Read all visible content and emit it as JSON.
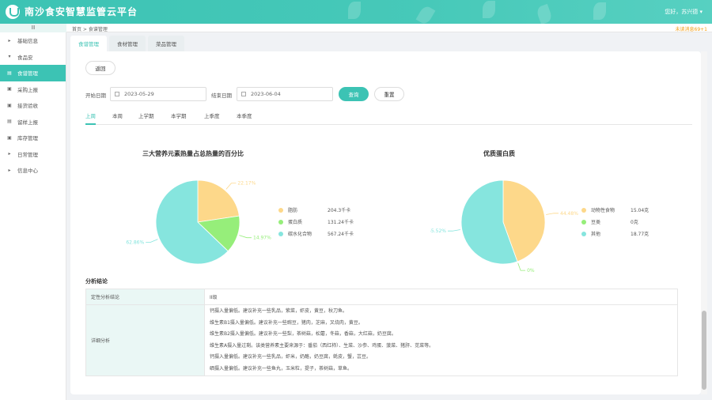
{
  "header": {
    "title": "南沙食安智慧监管云平台",
    "user": "您好，苏兴德 ▾"
  },
  "subbar": {
    "collapse_icon": "Ⅲ",
    "breadcrumb": "首页 > 食谱管理",
    "notice": "未读消息69+1"
  },
  "sidebar": {
    "items": [
      {
        "label": "基础信息",
        "icon": "▸"
      },
      {
        "label": "食品安",
        "icon": "▾"
      },
      {
        "label": "食谱管理",
        "icon": "▤"
      },
      {
        "label": "采购上报",
        "icon": "▣"
      },
      {
        "label": "接货验收",
        "icon": "▣"
      },
      {
        "label": "留样上报",
        "icon": "▤"
      },
      {
        "label": "库存管理",
        "icon": "▣"
      },
      {
        "label": "日常管理",
        "icon": "▸"
      },
      {
        "label": "信息中心",
        "icon": "▸"
      }
    ]
  },
  "tabs": [
    {
      "label": "食谱管理"
    },
    {
      "label": "食材管理"
    },
    {
      "label": "菜品管理"
    }
  ],
  "toolbar": {
    "back_label": "返回"
  },
  "filters": {
    "start_label": "开始日期",
    "start_value": "2023-05-29",
    "end_label": "结束日期",
    "end_value": "2023-06-04",
    "search_label": "查询",
    "reset_label": "重置"
  },
  "periods": [
    {
      "label": "上周"
    },
    {
      "label": "本周"
    },
    {
      "label": "上学期"
    },
    {
      "label": "本学期"
    },
    {
      "label": "上季度"
    },
    {
      "label": "本季度"
    }
  ],
  "chart_data": [
    {
      "type": "pie",
      "title": "三大营养元素热量占总热量的百分比",
      "series": [
        {
          "name": "脂肪",
          "value": 204.3,
          "value_label": "204.3千卡",
          "percent_label": "22.17%",
          "color": "#fdd88a"
        },
        {
          "name": "蛋白质",
          "value": 131.24,
          "value_label": "131.24千卡",
          "percent_label": "14.97%",
          "color": "#96ee7a"
        },
        {
          "name": "碳水化合物",
          "value": 567.24,
          "value_label": "567.24千卡",
          "percent_label": "62.86%",
          "color": "#86e5de"
        }
      ]
    },
    {
      "type": "pie",
      "title": "优质蛋白质",
      "series": [
        {
          "name": "动物性食物",
          "value": 15.04,
          "value_label": "15.04克",
          "percent_label": "44.48%",
          "color": "#fdd88a"
        },
        {
          "name": "豆类",
          "value": 0,
          "value_label": "0克",
          "percent_label": "0%",
          "color": "#96ee7a"
        },
        {
          "name": "其他",
          "value": 18.77,
          "value_label": "18.77克",
          "percent_label": "55.52%",
          "color": "#86e5de"
        }
      ]
    }
  ],
  "analysis": {
    "title": "分析结论",
    "rating_label": "定性分析结论",
    "rating_value": "II级",
    "detail_label": "详细分析",
    "details": [
      "钙摄入量偏低。建议补充一些乳品，紫菜，虾皮，黄豆，秋刀鱼。",
      "维生素B1摄入量偏低。建议补充一些豌豆，猪肉，芝麻，叉烧肉，黄豆。",
      "维生素B2摄入量偏低。建议补充一些梨，茶树菇，松蘑，冬菇，香菇，大红菇，奶豆腐。",
      "维生素A摄入量过剩。该类营养素主要来源于：番茄（西红柿）、生菜、沙参、鸡蛋、菠菜、猪肝、苋菜等。",
      "钙摄入量偏低。建议补充一些乳品，虾米，奶酪，奶豆腐，蚝皮，蟹，芸豆。",
      "硒摄入量偏低。建议补充一些鱼丸，玉米粒，提子，茶树菇，草鱼。"
    ]
  }
}
